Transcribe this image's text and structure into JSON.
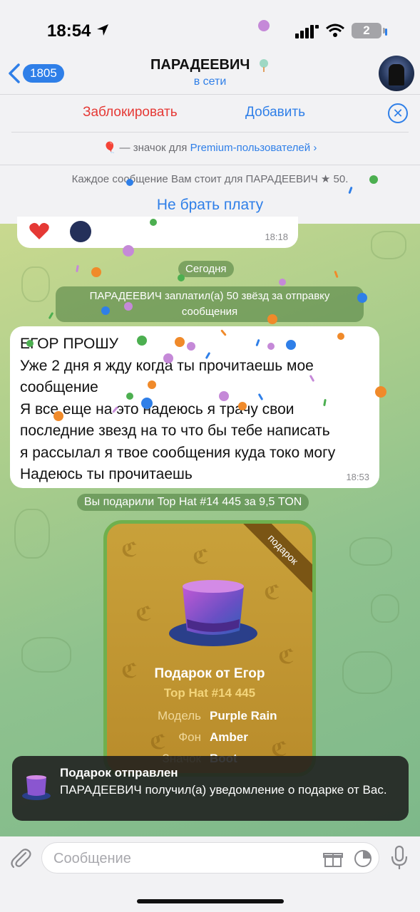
{
  "status_bar": {
    "time": "18:54",
    "battery": "2"
  },
  "nav": {
    "back_count": "1805",
    "title": "ПАРАДЕЕВИЧ",
    "subtitle": "в сети"
  },
  "actions": {
    "block": "Заблокировать",
    "add": "Добавить"
  },
  "premium": {
    "prefix": "— значок для ",
    "link": "Premium-пользователей",
    "chevron": "›"
  },
  "paid_messages": {
    "text": "Каждое сообщение Вам стоит для ПАРАДЕЕВИЧ ★ 50.",
    "link": "Не брать плату"
  },
  "prev_message": {
    "time": "18:18"
  },
  "service": {
    "date": "Сегодня",
    "paid": "ПАРАДЕЕВИЧ заплатил(а) 50 звёзд за отправку сообщения",
    "gift": "Вы подарили Top Hat #14 445 за 9,5 TON"
  },
  "message": {
    "lines": [
      "ЕГОР ПРОШУ",
      "Уже 2 дня я жду когда ты прочитаешь мое",
      "сообщение",
      "Я все еще на это надеюсь я трачу свои",
      "последние звезд на то что бы тебе написать",
      "я рассылал я твое сообщения куда токо могу",
      "Надеюсь ты прочитаешь"
    ],
    "time": "18:53"
  },
  "gift_card": {
    "ribbon": "подарок",
    "from": "Подарок от Егор",
    "name": "Top Hat #14 445",
    "attributes": [
      {
        "key": "Модель",
        "value": "Purple Rain"
      },
      {
        "key": "Фон",
        "value": "Amber"
      },
      {
        "key": "Значок",
        "value": "Boot"
      }
    ]
  },
  "toast": {
    "title": "Подарок отправлен",
    "body": "ПАРАДЕЕВИЧ получил(а) уведомление о подарке от Вас."
  },
  "composer": {
    "placeholder": "Сообщение"
  },
  "colors": {
    "accent": "#2f7fe8",
    "danger": "#e53935",
    "chat_green": "#8fc28e",
    "gift_gold": "#c9a13a"
  }
}
